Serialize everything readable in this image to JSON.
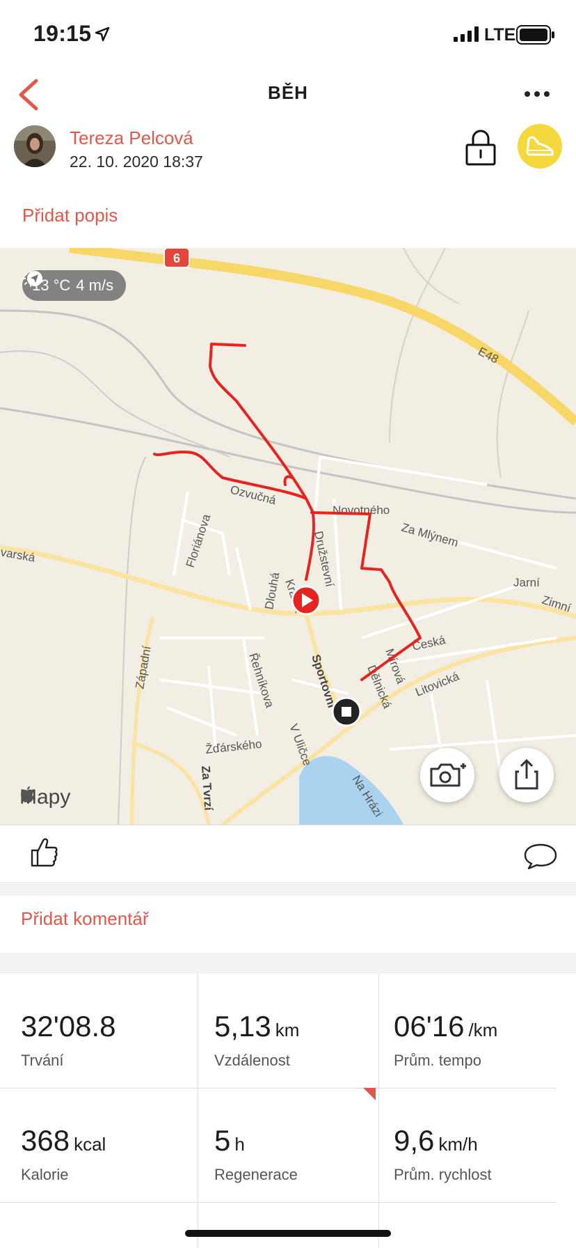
{
  "status_bar": {
    "time": "19:15",
    "network": "LTE"
  },
  "nav": {
    "title": "BĚH"
  },
  "user": {
    "name": "Tereza Pelcová",
    "date": "22. 10. 2020 18:37"
  },
  "add_description": "Přidat popis",
  "map": {
    "weather": {
      "temperature": "13 °C",
      "wind": "4 m/s"
    },
    "brand": "Mapy",
    "road_badge": "6",
    "labels": {
      "e48": "E48",
      "novotneho": "Novotného",
      "za_mlynem": "Za Mlýnem",
      "jarni": "Jarní",
      "zimni": "Zimní",
      "varska": "varská",
      "florianova": "Floriánova",
      "dlouha": "Dlouhá",
      "kratka": "Krátká",
      "druzstevni": "Družstevní",
      "sportovni": "Sportovní",
      "ceska": "Česká",
      "mirova": "Mírová",
      "delnicka": "Dělnická",
      "litovicka": "Litovická",
      "zapadni": "Západní",
      "rehnikova": "Řehníkova",
      "zdarskeho": "Žďárského",
      "v_ulicce": "V Uličce",
      "za_tvrzi": "Za Tvrzí",
      "na_hrazi": "Na Hrázi",
      "ozvucna": "Ozvučná"
    }
  },
  "comment": {
    "add_comment": "Přidat komentář"
  },
  "stats": [
    {
      "value": "32'08.8",
      "unit": "",
      "label": "Trvání"
    },
    {
      "value": "5,13",
      "unit": "km",
      "label": "Vzdálenost"
    },
    {
      "value": "06'16",
      "unit": "/km",
      "label": "Prům. tempo"
    },
    {
      "value": "368",
      "unit": "kcal",
      "label": "Kalorie"
    },
    {
      "value": "5",
      "unit": "h",
      "label": "Regenerace"
    },
    {
      "value": "9,6",
      "unit": "km/h",
      "label": "Prům. rychlost"
    }
  ],
  "colors": {
    "accent": "#e2574c",
    "badge": "#f4d83d",
    "route": "#e52420",
    "water": "#aad3ef",
    "highway": "#f7d768"
  }
}
